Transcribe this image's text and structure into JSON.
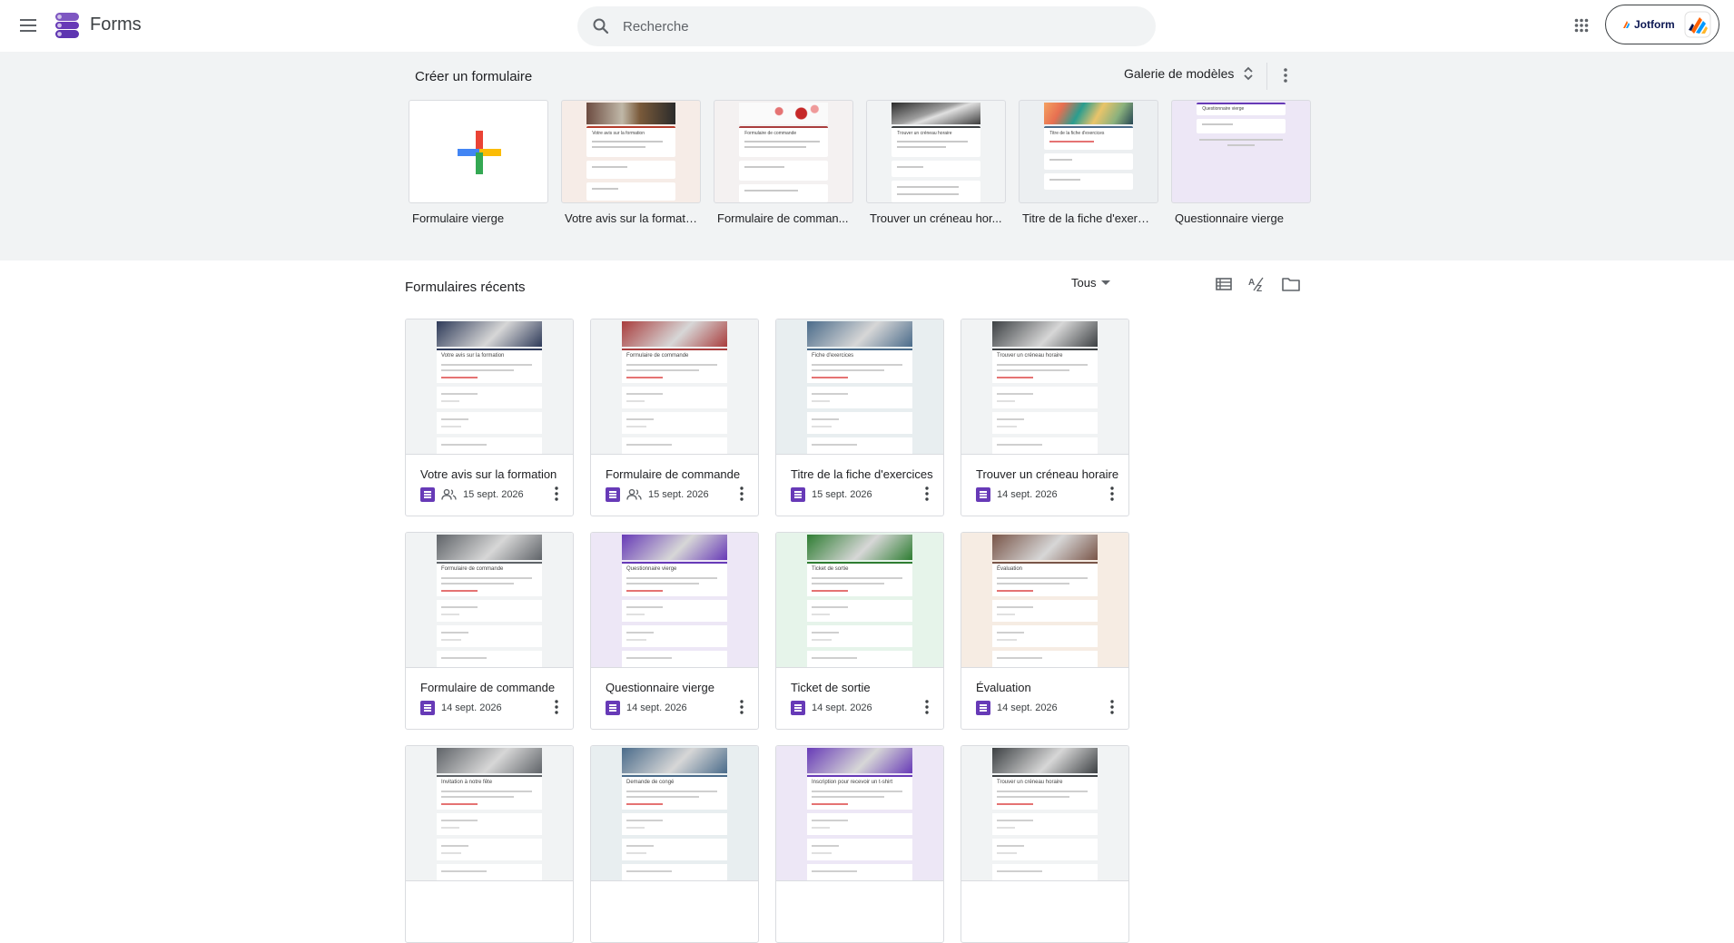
{
  "header": {
    "app_name": "Forms",
    "search_placeholder": "Recherche",
    "jotform_label": "Jotform"
  },
  "create": {
    "title": "Créer un formulaire",
    "gallery_label": "Galerie de modèles",
    "templates": [
      {
        "label": "Formulaire vierge",
        "icon": "plus-icon"
      },
      {
        "label": "Votre avis sur la formati...",
        "thumb_title": "Votre avis sur la formation",
        "accent": "#b53c2b"
      },
      {
        "label": "Formulaire de comman...",
        "thumb_title": "Formulaire de commande",
        "accent": "#a93d3d"
      },
      {
        "label": "Trouver un créneau hor...",
        "thumb_title": "Trouver un créneau horaire",
        "accent": "#3c4043"
      },
      {
        "label": "Titre de la fiche d'exerci...",
        "thumb_title": "Titre de la fiche d'exercices",
        "accent": "#4a6b8a"
      },
      {
        "label": "Questionnaire vierge",
        "thumb_title": "Questionnaire vierge",
        "accent": "#673ab7"
      }
    ]
  },
  "recent": {
    "title": "Formulaires récents",
    "filter_label": "Tous",
    "docs": [
      {
        "name": "Votre avis sur la formation",
        "date": "15 sept. 2026",
        "shared": true,
        "thumb_title": "Votre avis sur la formation",
        "accent": "#2e3a59",
        "bg": "#f1f3f4"
      },
      {
        "name": "Formulaire de commande",
        "date": "15 sept. 2026",
        "shared": true,
        "thumb_title": "Formulaire de commande",
        "accent": "#a93d3d",
        "bg": "#f1f3f4"
      },
      {
        "name": "Titre de la fiche d'exercices",
        "date": "15 sept. 2026",
        "shared": false,
        "thumb_title": "Fiche d'exercices",
        "accent": "#4a6b8a",
        "bg": "#e8eef0"
      },
      {
        "name": "Trouver un créneau horaire",
        "date": "14 sept. 2026",
        "shared": false,
        "thumb_title": "Trouver un créneau horaire",
        "accent": "#3c4043",
        "bg": "#f1f3f4"
      },
      {
        "name": "Formulaire de commande",
        "date": "14 sept. 2026",
        "shared": false,
        "thumb_title": "Formulaire de commande",
        "accent": "#5f6368",
        "bg": "#f1f3f4"
      },
      {
        "name": "Questionnaire vierge",
        "date": "14 sept. 2026",
        "shared": false,
        "thumb_title": "Questionnaire vierge",
        "accent": "#673ab7",
        "bg": "#ede7f6"
      },
      {
        "name": "Ticket de sortie",
        "date": "14 sept. 2026",
        "shared": false,
        "thumb_title": "Ticket de sortie",
        "accent": "#2e7d32",
        "bg": "#e6f4ea"
      },
      {
        "name": "Évaluation",
        "date": "14 sept. 2026",
        "shared": false,
        "thumb_title": "Évaluation",
        "accent": "#795548",
        "bg": "#f6ece3"
      },
      {
        "name": "",
        "date": "",
        "shared": false,
        "thumb_title": "Invitation à notre fête",
        "accent": "#5f6368",
        "bg": "#f1f3f4"
      },
      {
        "name": "",
        "date": "",
        "shared": false,
        "thumb_title": "Demande de congé",
        "accent": "#4a6b8a",
        "bg": "#e8eef0"
      },
      {
        "name": "",
        "date": "",
        "shared": false,
        "thumb_title": "Inscription pour recevoir un t-shirt",
        "accent": "#673ab7",
        "bg": "#ede7f6"
      },
      {
        "name": "",
        "date": "",
        "shared": false,
        "thumb_title": "Trouver un créneau horaire",
        "accent": "#3c4043",
        "bg": "#f1f3f4"
      }
    ]
  }
}
